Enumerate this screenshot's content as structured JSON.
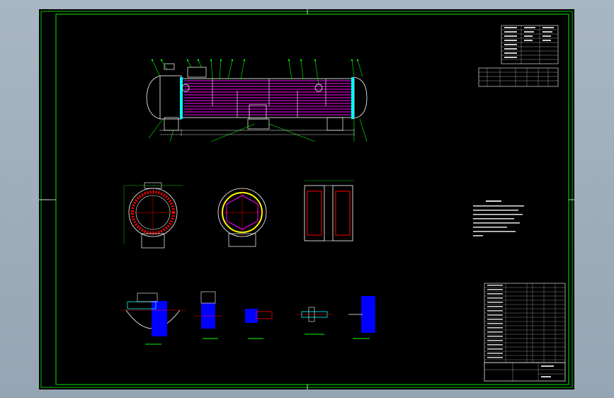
{
  "window": {
    "title": "",
    "background_color": "#a5b2bf"
  },
  "canvas": {
    "background_color": "#000000",
    "frame_color": "#00c800"
  },
  "colors": {
    "tube_bundle": "#ff00ff",
    "shell_outline": "#ffffff",
    "leader_lines": "#00ff00",
    "fill_blue": "#0000ff",
    "outline_cyan": "#00ffff",
    "flange_red": "#ff0000",
    "hatch_yellow": "#ffff00"
  },
  "drawing": {
    "title_block_label": "",
    "icons": [
      "crosshair-icon"
    ]
  }
}
